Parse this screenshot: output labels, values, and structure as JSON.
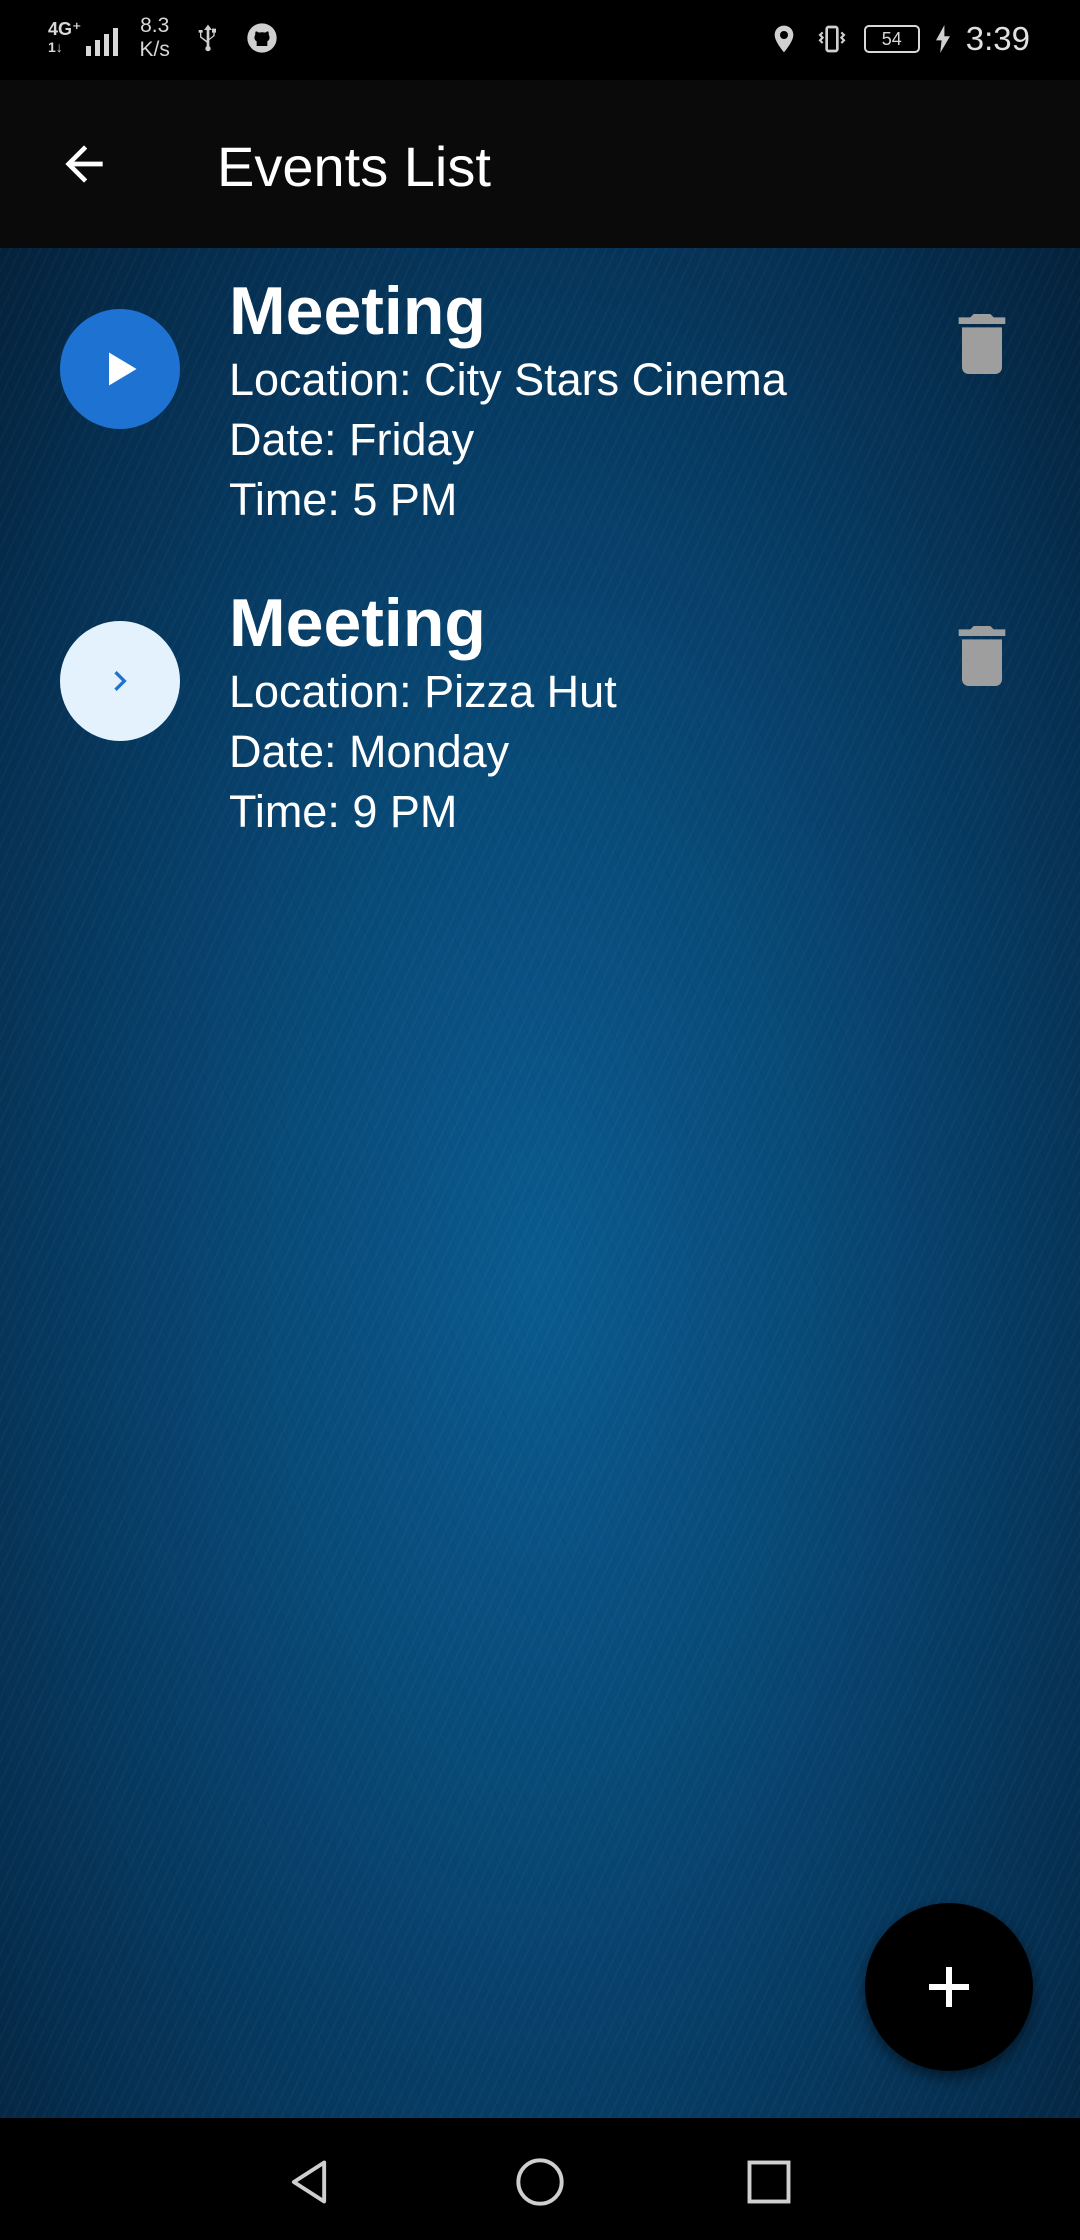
{
  "status_bar": {
    "network_type": "4G⁺",
    "network_sub": "1↓",
    "speed_value": "8.3",
    "speed_unit": "K/s",
    "battery_level": "54",
    "time": "3:39"
  },
  "app_bar": {
    "title": "Events List"
  },
  "events": [
    {
      "title": "Meeting",
      "location": "Location: City Stars Cinema",
      "date": "Date: Friday",
      "time": "Time: 5 PM",
      "state": "playing"
    },
    {
      "title": "Meeting",
      "location": "Location: Pizza Hut",
      "date": "Date: Monday",
      "time": "Time: 9 PM",
      "state": "idle"
    }
  ],
  "colors": {
    "playing_avatar": "#1e73d2",
    "idle_avatar": "#e3f2fd",
    "delete_icon": "#9e9e9e",
    "background": "#084a78"
  },
  "icons": [
    "back-arrow-icon",
    "play-icon",
    "chevron-right-icon",
    "trash-icon",
    "plus-icon"
  ]
}
